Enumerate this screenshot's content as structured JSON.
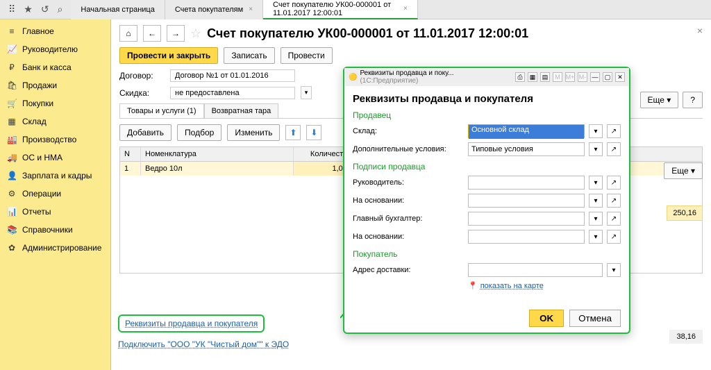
{
  "tabs": {
    "home": "Начальная страница",
    "invoices": "Счета покупателям",
    "invoice": "Счет покупателю УК00-000001 от 11.01.2017 12:00:01"
  },
  "sidebar": [
    {
      "icon": "≡",
      "label": "Главное"
    },
    {
      "icon": "📈",
      "label": "Руководителю"
    },
    {
      "icon": "₽",
      "label": "Банк и касса"
    },
    {
      "icon": "🛍",
      "label": "Продажи"
    },
    {
      "icon": "🛒",
      "label": "Покупки"
    },
    {
      "icon": "▦",
      "label": "Склад"
    },
    {
      "icon": "🏭",
      "label": "Производство"
    },
    {
      "icon": "🚚",
      "label": "ОС и НМА"
    },
    {
      "icon": "👤",
      "label": "Зарплата и кадры"
    },
    {
      "icon": "⚙",
      "label": "Операции"
    },
    {
      "icon": "📊",
      "label": "Отчеты"
    },
    {
      "icon": "📚",
      "label": "Справочники"
    },
    {
      "icon": "✿",
      "label": "Администрирование"
    }
  ],
  "page": {
    "title": "Счет покупателю УК00-000001 от 11.01.2017 12:00:01",
    "post_close": "Провести и закрыть",
    "write": "Записать",
    "post": "Провести",
    "more": "Еще",
    "help": "?"
  },
  "form": {
    "contract_label": "Договор:",
    "contract_value": "Договор №1 от 01.01.2016",
    "discount_label": "Скидка:",
    "discount_value": "не предоставлена"
  },
  "tabset": {
    "goods": "Товары и услуги (1)",
    "tare": "Возвратная тара"
  },
  "subtoolbar": {
    "add": "Добавить",
    "pick": "Подбор",
    "edit": "Изменить",
    "more": "Еще"
  },
  "table": {
    "h_n": "N",
    "h_nom": "Номенклатура",
    "h_qty": "Количество",
    "r1_n": "1",
    "r1_nom": "Ведро 10л",
    "r1_qty": "1,000"
  },
  "right_value": "250,16",
  "footer_value": "38,16",
  "callout_link": "Реквизиты продавца и покупателя",
  "edo_link": "Подключить \"ООО \"УК \"Чистый дом\"\" к ЭДО",
  "dialog": {
    "titlebar": "Реквизиты продавца и поку...",
    "titlebar_suffix": "(1С:Предприятие)",
    "title": "Реквизиты продавца и покупателя",
    "seller": "Продавец",
    "warehouse_label": "Склад:",
    "warehouse_value": "Основной склад",
    "extra_label": "Дополнительные условия:",
    "extra_value": "Типовые условия",
    "sign_section": "Подписи продавца",
    "manager_label": "Руководитель:",
    "basis1_label": "На основании:",
    "accountant_label": "Главный бухгалтер:",
    "basis2_label": "На основании:",
    "buyer": "Покупатель",
    "delivery_label": "Адрес доставки:",
    "map_link": "показать на карте",
    "ok": "OK",
    "cancel": "Отмена"
  }
}
